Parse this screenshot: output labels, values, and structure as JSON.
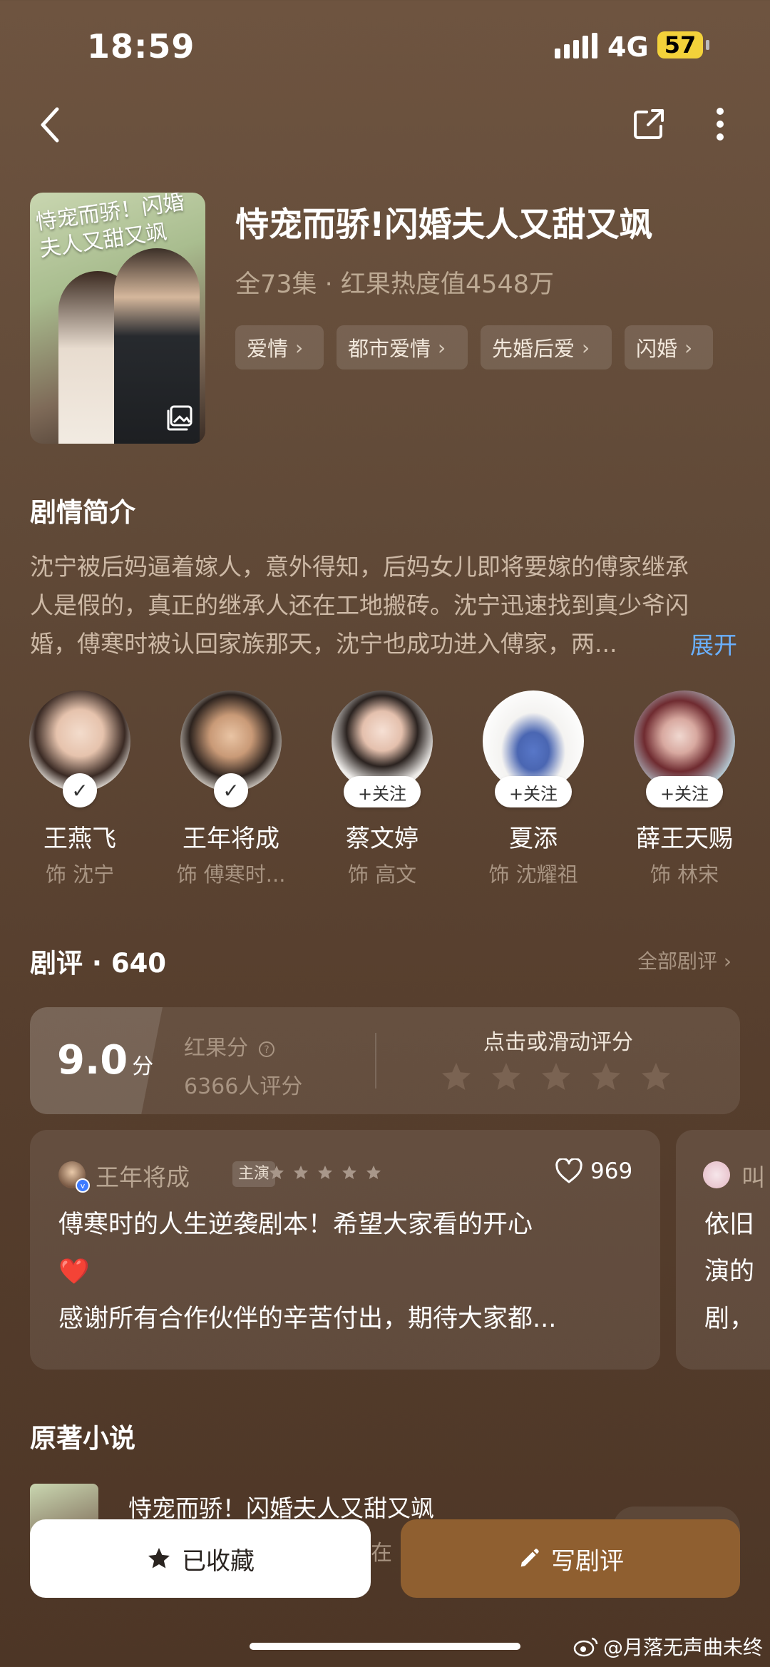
{
  "status_bar": {
    "time": "18:59",
    "network": "4G",
    "battery": "57"
  },
  "drama": {
    "title": "恃宠而骄!闪婚夫人又甜又飒",
    "meta": "全73集 · 红果热度值4548万",
    "poster_text": "恃宠而骄！闪婚夫人又甜又飒",
    "tags": [
      {
        "label": "爱情"
      },
      {
        "label": "都市爱情"
      },
      {
        "label": "先婚后爱"
      },
      {
        "label": "闪婚"
      }
    ]
  },
  "synopsis": {
    "heading": "剧情简介",
    "lines": [
      "沈宁被后妈逼着嫁人，意外得知，后妈女儿即将要嫁的傅家继承",
      "人是假的，真正的继承人还在工地搬砖。沈宁迅速找到真少爷闪",
      "婚，傅寒时被认回家族那天，沈宁也成功进入傅家，两..."
    ],
    "expand_label": "展开"
  },
  "cast": [
    {
      "name": "王燕飞",
      "role": "饰 沈宁",
      "followed": true,
      "badge": "✓"
    },
    {
      "name": "王年将成",
      "role": "饰 傅寒时...",
      "followed": true,
      "badge": "✓"
    },
    {
      "name": "蔡文婷",
      "role": "饰 高文",
      "followed": false,
      "badge": "+关注"
    },
    {
      "name": "夏添",
      "role": "饰 沈耀祖",
      "followed": false,
      "badge": "+关注"
    },
    {
      "name": "薛王天赐",
      "role": "饰 林宋",
      "followed": false,
      "badge": "+关注"
    }
  ],
  "reviews": {
    "heading": "剧评 · 640",
    "all_label": "全部剧评",
    "score": "9.0",
    "score_unit": "分",
    "score_label": "红果分",
    "rating_count": "6366人评分",
    "rate_prompt": "点击或滑动评分",
    "items": [
      {
        "author": "王年将成",
        "tag": "主演",
        "stars": 5,
        "likes": "969",
        "lines": [
          "傅寒时的人生逆袭剧本！希望大家看的开心",
          "❤️",
          "感谢所有合作伙伴的辛苦付出，期待大家都..."
        ]
      },
      {
        "author": "叫",
        "lines": [
          "依旧",
          "演的",
          "剧，"
        ]
      }
    ]
  },
  "novel": {
    "heading": "原著小说",
    "title": "恃宠而骄！闪婚夫人又甜又飒",
    "sub": "在"
  },
  "actions": {
    "favorite_label": "已收藏",
    "review_label": "写剧评"
  },
  "watermark": "@月落无声曲未终",
  "colors": {
    "accent_blue": "#6ab0ff",
    "write_button": "#8f5f30",
    "battery": "#f3d23a"
  }
}
